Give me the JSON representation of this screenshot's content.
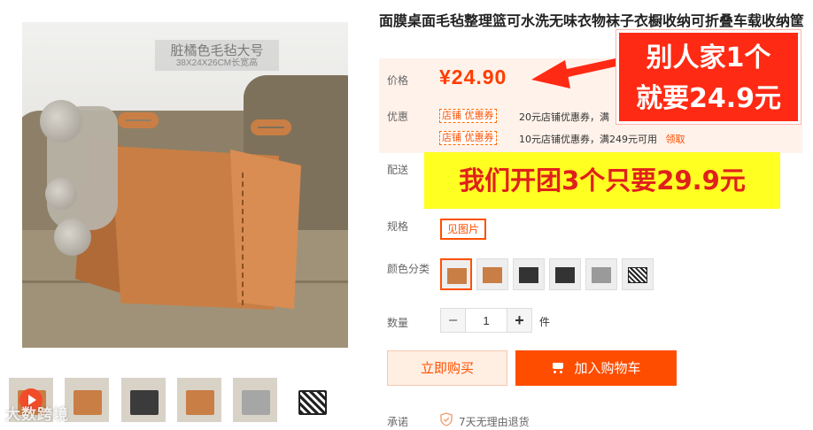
{
  "image": {
    "label_line1": "脏橘色毛毡大号",
    "label_line2": "38X24X26CM长宽高"
  },
  "watermark": "大数跨境",
  "product": {
    "title": "面膜桌面毛毡整理篮可水洗无味衣物袜子衣橱收纳可折叠车载收纳筐",
    "price_label": "价格",
    "price": "¥24.90",
    "promo_label": "优惠",
    "coupons": [
      {
        "tag": "店铺 优惠券",
        "text": "20元店铺优惠券，满",
        "link": ""
      },
      {
        "tag": "店铺 优惠券",
        "text": "10元店铺优惠券，满249元可用",
        "link": "领取"
      }
    ],
    "delivery_label": "配送",
    "spec_label": "规格",
    "spec_value": "见图片",
    "color_label": "颜色分类",
    "qty_label": "数量",
    "qty_value": "1",
    "qty_unit": "件",
    "buy_now": "立即购买",
    "add_to_cart": "加入购物车",
    "promise_label": "承诺",
    "promise_text": "7天无理由退货"
  },
  "overlays": {
    "red_callout_line1": "别人家1个",
    "red_callout_line2": "就要24.9元",
    "yellow_callout": "我们开团3个只要29.9元"
  },
  "colors": {
    "accent": "#ff5000",
    "callout_red": "#ff2a14",
    "callout_yellow": "#ffff22"
  },
  "icons": [
    "play-icon",
    "cart-icon",
    "shield-icon",
    "red-arrow-icon"
  ]
}
